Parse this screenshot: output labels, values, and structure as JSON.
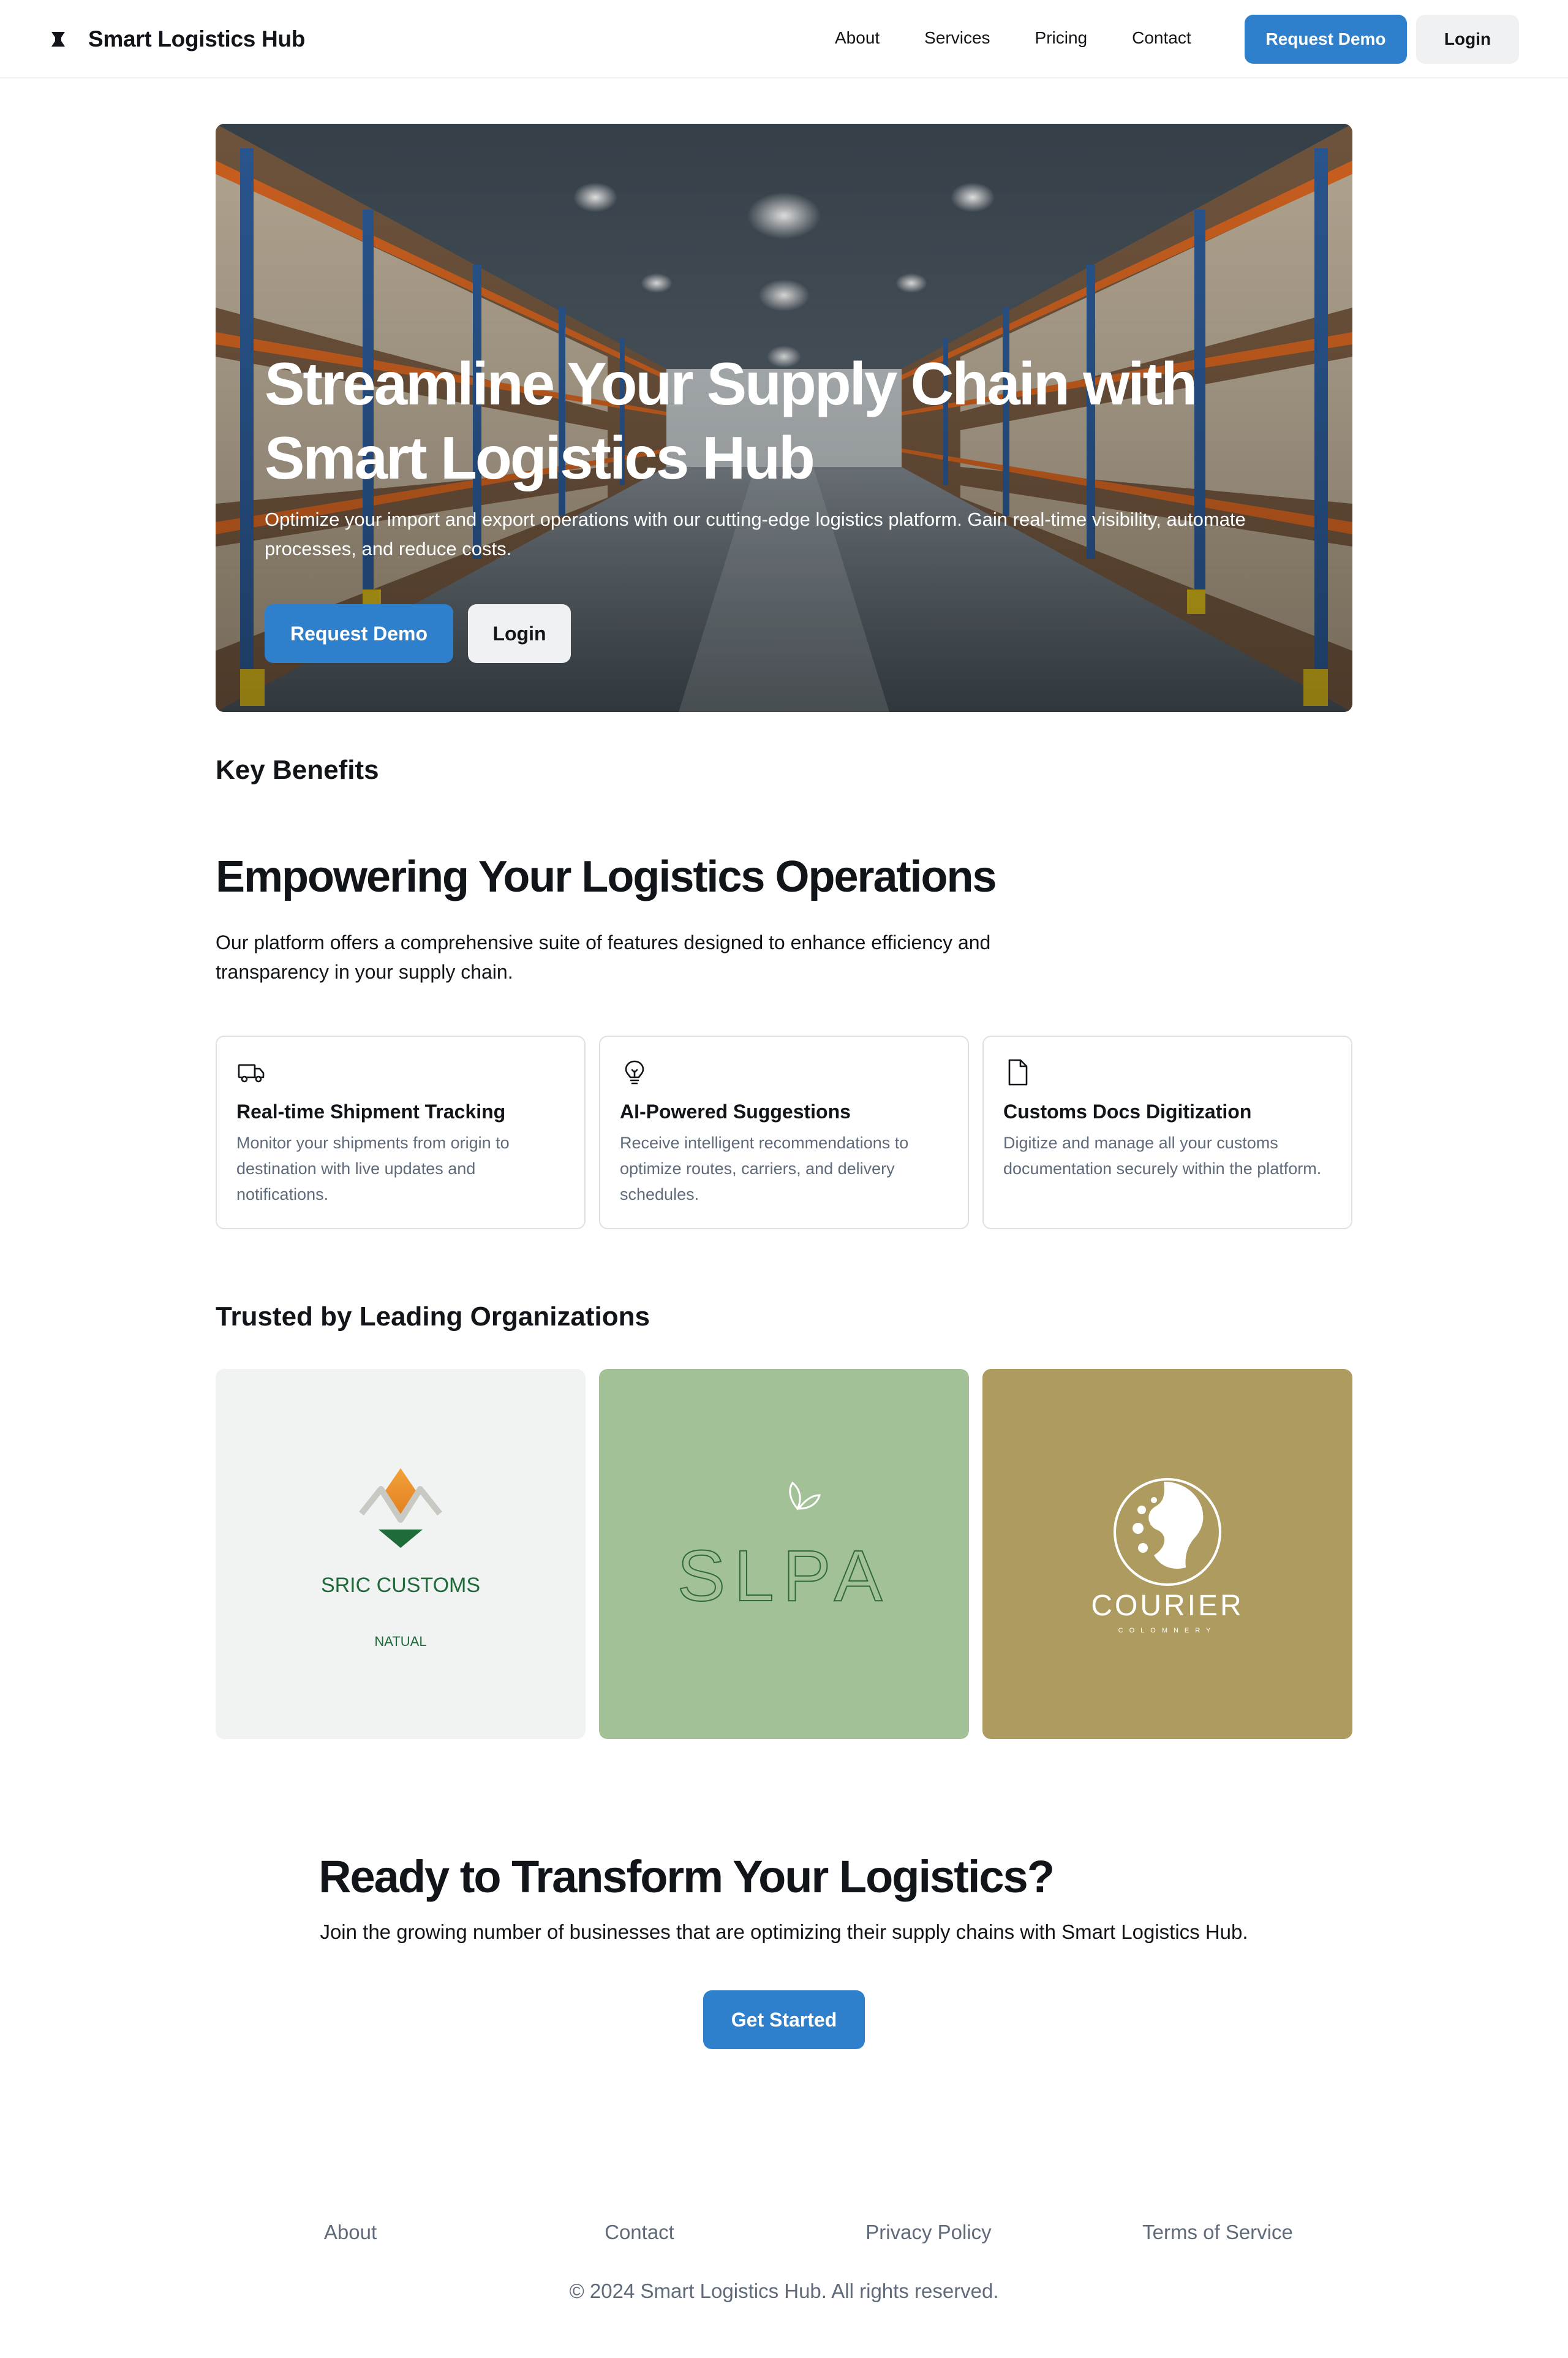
{
  "nav": {
    "brand": "Smart Logistics Hub",
    "links": [
      "About",
      "Services",
      "Pricing",
      "Contact"
    ],
    "request_demo": "Request Demo",
    "login": "Login"
  },
  "hero": {
    "title": "Streamline Your Supply Chain with Smart Logistics Hub",
    "subtitle": "Optimize your import and export operations with our cutting-edge logistics platform. Gain real-time visibility, automate processes, and reduce costs.",
    "request_demo": "Request Demo",
    "login": "Login"
  },
  "benefits": {
    "heading": "Key Benefits",
    "title": "Empowering Your Logistics Operations",
    "subtitle": "Our platform offers a comprehensive suite of features designed to enhance efficiency and transparency in your supply chain.",
    "cards": [
      {
        "icon": "truck-icon",
        "title": "Real-time Shipment Tracking",
        "desc": "Monitor your shipments from origin to destination with live updates and notifications."
      },
      {
        "icon": "lightbulb-icon",
        "title": "AI-Powered Suggestions",
        "desc": "Receive intelligent recommendations to optimize routes, carriers, and delivery schedules."
      },
      {
        "icon": "document-icon",
        "title": "Customs Docs Digitization",
        "desc": "Digitize and manage all your customs documentation securely within the platform."
      }
    ]
  },
  "trusted": {
    "title": "Trusted by Leading Organizations",
    "logos": [
      {
        "name": "SRIC CUSTOMS",
        "tagline": "NATUAL",
        "bg": "#f1f2f2"
      },
      {
        "name": "SLPA",
        "bg": "#a3c197"
      },
      {
        "name": "COURIER",
        "tagline": "COLOMNERY",
        "bg": "#ad9b5f"
      }
    ]
  },
  "cta": {
    "title": "Ready to Transform Your Logistics?",
    "subtitle": "Join the growing number of businesses that are optimizing their supply chains with Smart Logistics Hub.",
    "button": "Get Started"
  },
  "footer": {
    "links": [
      "About",
      "Contact",
      "Privacy Policy",
      "Terms of Service"
    ],
    "copyright": "© 2024 Smart Logistics Hub. All rights reserved."
  },
  "colors": {
    "accent": "#2f80cc",
    "muted_text": "#5f6b7a"
  }
}
